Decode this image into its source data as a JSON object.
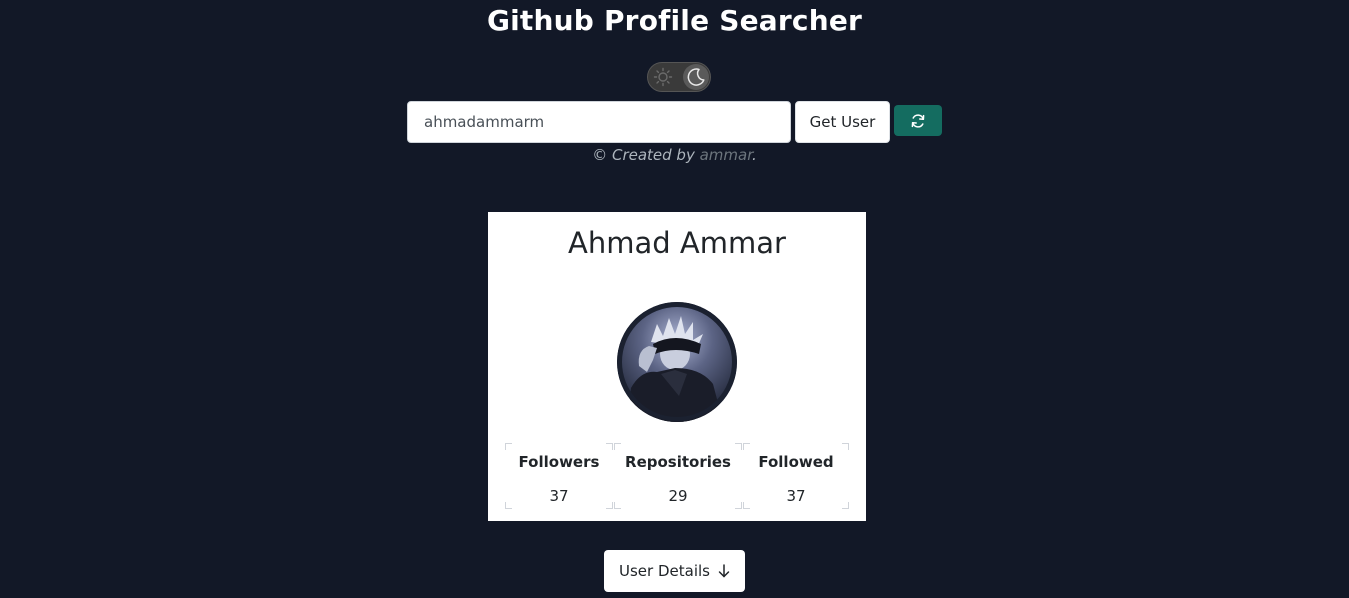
{
  "header": {
    "title": "Github Profile Searcher"
  },
  "theme_toggle": {
    "state": "dark",
    "icons": [
      "sun-icon",
      "moon-icon"
    ]
  },
  "search": {
    "value": "ahmadammarm",
    "button_label": "Get User",
    "refresh_icon": "refresh-icon"
  },
  "credit": {
    "prefix": "© Created by ",
    "author": "ammar",
    "suffix": "."
  },
  "profile": {
    "name": "Ahmad Ammar",
    "stats": [
      {
        "label": "Followers",
        "value": "37"
      },
      {
        "label": "Repositories",
        "value": "29"
      },
      {
        "label": "Followed",
        "value": "37"
      }
    ]
  },
  "details_button": {
    "label": "User Details",
    "icon": "arrow-down-icon"
  },
  "colors": {
    "background": "#121827",
    "card": "#ffffff",
    "accent": "#146c60"
  }
}
